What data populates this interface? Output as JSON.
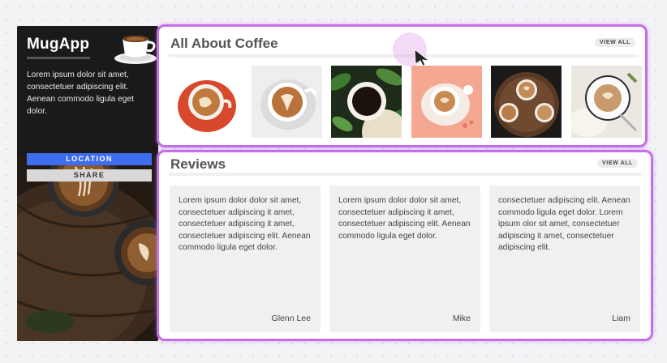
{
  "sidebar": {
    "brand": "MugApp",
    "description": "Lorem ipsum dolor sit amet, consectetuer adipiscing elit. Aenean commodo ligula eget dolor.",
    "location_button": "LOCATION",
    "share_button": "SHARE"
  },
  "coffee": {
    "title": "All About Coffee",
    "view_all": "VIEW ALL",
    "photos": [
      "coffee-photo-1",
      "coffee-photo-2",
      "coffee-photo-3",
      "coffee-photo-4",
      "coffee-photo-5",
      "coffee-photo-6"
    ]
  },
  "reviews": {
    "title": "Reviews",
    "view_all": "VIEW ALL",
    "items": [
      {
        "text": "Lorem ipsum dolor dolor sit amet, consectetuer adipiscing it amet, consectetuer adipiscing it amet, consectetuer adipiscing elit. Aenean commodo ligula eget dolor.",
        "author": "Glenn Lee"
      },
      {
        "text": "Lorem ipsum dolor dolor sit amet, consectetuer adipiscing it amet, consectetuer adipiscing elit. Aenean commodo ligula eget dolor.",
        "author": "Mike"
      },
      {
        "text": "consectetuer adipiscing elit. Aenean commodo ligula eget dolor. Lorem ipsum olor sit amet, consectetuer adipiscing it amet, consectetuer adipiscing elit.",
        "author": "Liam"
      }
    ]
  },
  "colors": {
    "panel_border": "#c46ee8",
    "location_button": "#3f6df0",
    "sidebar_bg": "#1a1a1a"
  },
  "icons": [
    "mug-logo-icon",
    "cursor-icon"
  ]
}
